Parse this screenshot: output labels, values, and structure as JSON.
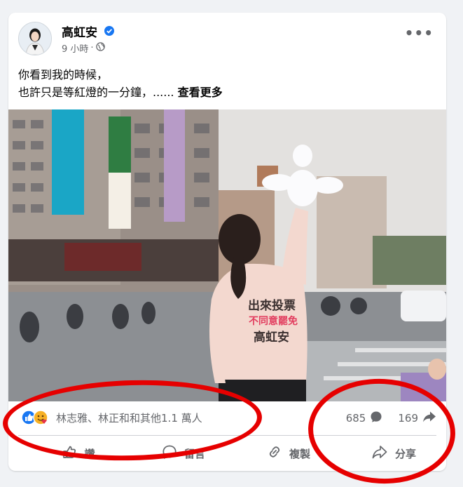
{
  "post": {
    "author": "高虹安",
    "time": "9 小時",
    "separator": "·",
    "text_line1": "你看到我的時候，",
    "text_line2": "也許只是等紅燈的一分鐘，......",
    "see_more": "查看更多"
  },
  "photo": {
    "jacket_line1": "出來投票",
    "jacket_line2": "不同意罷免",
    "jacket_line3": "高虹安"
  },
  "reactions": {
    "names": "林志雅、林正和和其他1.1 萬人",
    "comments_count": "685",
    "shares_count": "169"
  },
  "actions": {
    "like": "讚",
    "comment": "留言",
    "copy": "複製",
    "share": "分享"
  },
  "colors": {
    "accent": "#1877f2",
    "annotation": "#e60000"
  }
}
